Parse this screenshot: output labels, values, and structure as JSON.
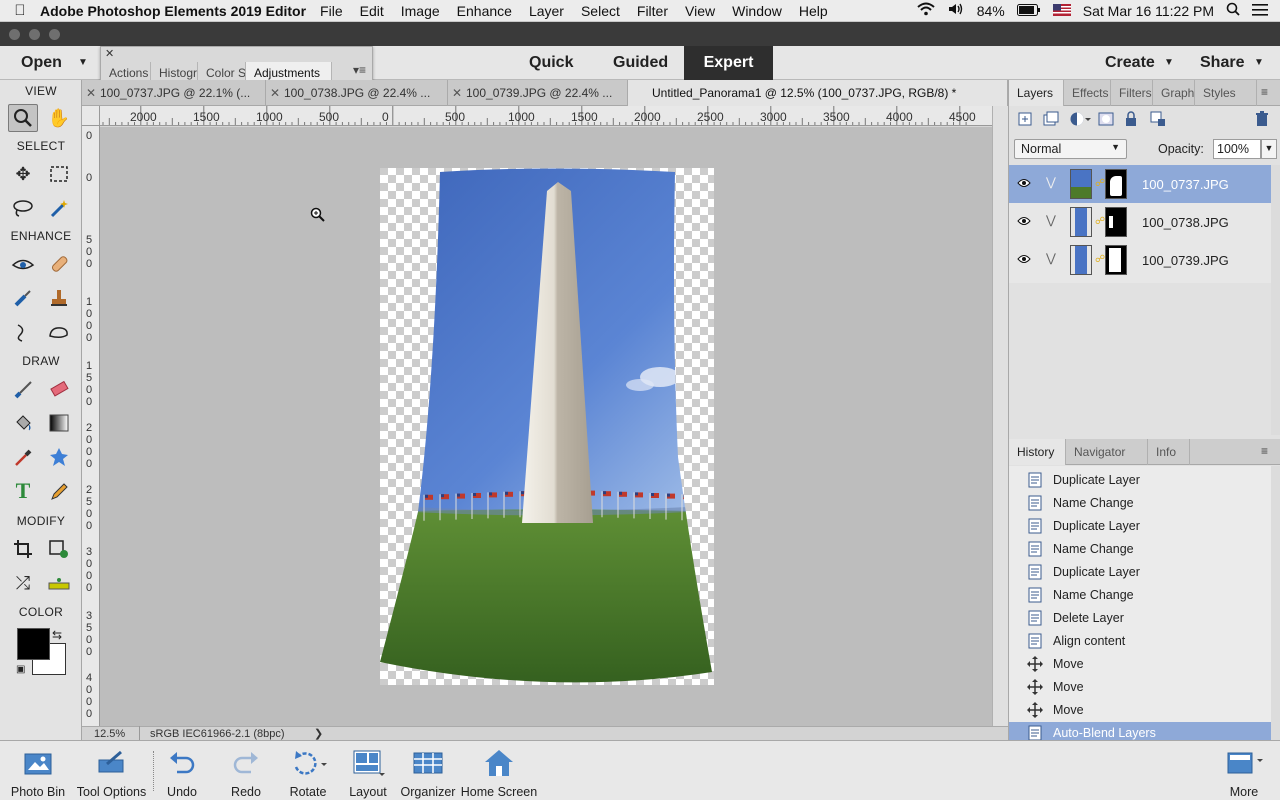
{
  "menubar": {
    "app_name": "Adobe Photoshop Elements 2019 Editor",
    "items": [
      "File",
      "Edit",
      "Image",
      "Enhance",
      "Layer",
      "Select",
      "Filter",
      "View",
      "Window",
      "Help"
    ],
    "battery": "84%",
    "datetime": "Sat Mar 16  11:22 PM"
  },
  "modebar": {
    "open_label": "Open",
    "modes": [
      "Quick",
      "Guided",
      "Expert"
    ],
    "active_mode": "Expert",
    "create_label": "Create",
    "share_label": "Share"
  },
  "float_panel": {
    "tabs": [
      "Actions",
      "Histogr",
      "Color S",
      "Adjustments"
    ],
    "active_tab": "Adjustments"
  },
  "doc_tabs": [
    "100_0737.JPG @ 22.1% (...",
    "100_0738.JPG @ 22.4% ...",
    "100_0739.JPG @ 22.4% ...",
    "Untitled_Panorama1 @ 12.5% (100_0737.JPG, RGB/8) *"
  ],
  "ruler": {
    "h_labels": [
      "2000",
      "1500",
      "1000",
      "500",
      "0",
      "500",
      "1000",
      "1500",
      "2000",
      "2500",
      "3000",
      "3500",
      "4000",
      "4500"
    ],
    "v_labels": [
      "0",
      "0",
      "500",
      "1000",
      "1500",
      "2000",
      "2500",
      "3000",
      "3500",
      "4000"
    ]
  },
  "toolbox": {
    "sections": [
      "VIEW",
      "SELECT",
      "ENHANCE",
      "DRAW",
      "MODIFY",
      "COLOR"
    ]
  },
  "status": {
    "zoom": "12.5%",
    "profile": "sRGB IEC61966-2.1 (8bpc)"
  },
  "layers_panel": {
    "tabs": [
      "Layers",
      "Effects",
      "Filters",
      "Graphi",
      "Styles"
    ],
    "active_tab": "Layers",
    "blend_mode": "Normal",
    "opacity_label": "Opacity:",
    "opacity_value": "100%",
    "layers": [
      "100_0737.JPG",
      "100_0738.JPG",
      "100_0739.JPG"
    ],
    "selected_layer": "100_0737.JPG"
  },
  "history_panel": {
    "tabs": [
      "History",
      "Navigator",
      "Info"
    ],
    "active_tab": "History",
    "items": [
      "Duplicate Layer",
      "Name Change",
      "Duplicate Layer",
      "Name Change",
      "Duplicate Layer",
      "Name Change",
      "Delete Layer",
      "Align content",
      "Move",
      "Move",
      "Move",
      "Auto-Blend Layers"
    ],
    "selected_item": "Auto-Blend Layers"
  },
  "bottombar": {
    "buttons": [
      "Photo Bin",
      "Tool Options",
      "Undo",
      "Redo",
      "Rotate",
      "Layout",
      "Organizer",
      "Home Screen"
    ],
    "more_label": "More"
  },
  "colors": {
    "accent_selection": "#8ea9d8",
    "mode_active_bg": "#2e2e2e",
    "foreground_color": "#000000",
    "background_color": "#ffffff"
  }
}
